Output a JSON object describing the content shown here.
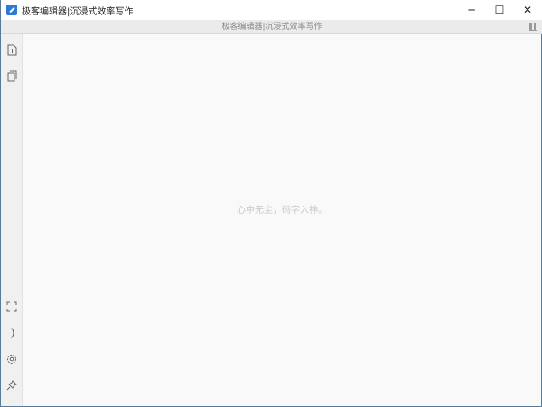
{
  "window": {
    "title": "极客编辑器|沉浸式效率写作",
    "minimize": "─",
    "maximize": "☐",
    "close": "✕"
  },
  "subbar": {
    "title": "极客编辑器|沉浸式效率写作"
  },
  "editor": {
    "placeholder": "心中无尘，码字入神。"
  },
  "sidebar": {
    "icons": [
      "new-file-icon",
      "copy-icon",
      "fullscreen-icon",
      "moon-icon",
      "gear-icon",
      "pin-icon"
    ]
  }
}
